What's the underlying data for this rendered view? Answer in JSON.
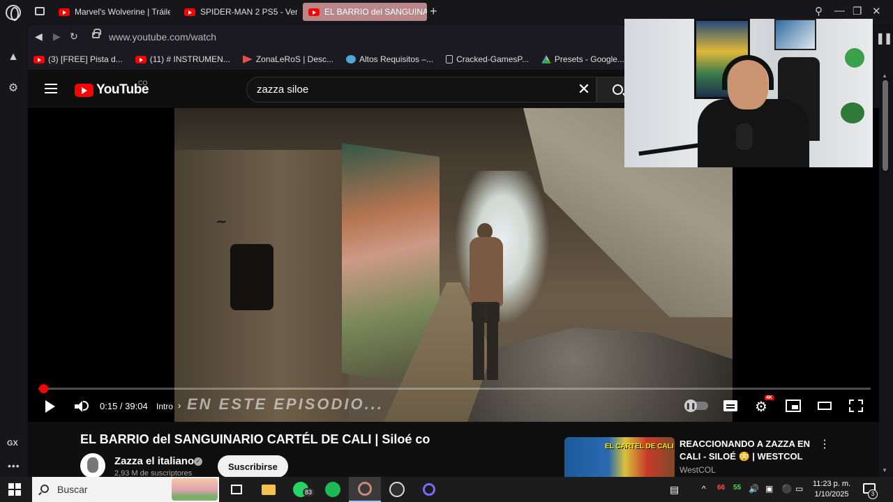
{
  "browser": {
    "tabs": [
      {
        "label": "Marvel's Wolverine | Tráile",
        "icon": "youtube-icon"
      },
      {
        "label": "SPIDER-MAN 2 PS5 - Ver",
        "icon": "youtube-icon"
      },
      {
        "label": "EL BARRIO del SANGUINAR",
        "icon": "youtube-icon",
        "active": true
      }
    ],
    "url": "www.youtube.com/watch",
    "bookmarks": [
      {
        "label": "(3) [FREE] Pista d...",
        "icon": "youtube-icon"
      },
      {
        "label": "(11) # INSTRUMEN...",
        "icon": "youtube-icon"
      },
      {
        "label": "ZonaLeRoS | Desc...",
        "icon": "zonaleros-icon"
      },
      {
        "label": "Altos Requisitos –...",
        "icon": "globe-icon"
      },
      {
        "label": "Cracked-GamesP...",
        "icon": "page-icon"
      },
      {
        "label": "Presets - Google...",
        "icon": "drive-icon"
      }
    ],
    "sidebar_label": "GX"
  },
  "youtube": {
    "logo_text": "YouTube",
    "country": "CO",
    "search_value": "zazza siloe",
    "player": {
      "time": "0:15 / 39:04",
      "chapter": "Intro",
      "caption_overlay": "EN ESTE EPISODIO...",
      "progress_fraction": 0.006,
      "quality_badge": "4K"
    },
    "video_title": "EL BARRIO del SANGUINARIO CARTÉL DE CALI | Siloé co",
    "channel": {
      "name": "Zazza el italiano",
      "subscribers": "2,93 M de suscriptores",
      "subscribe_label": "Suscribirse"
    },
    "recommended": {
      "title": "REACCIONANDO A ZAZZA EN CALI - SILOÉ 😳 | WESTCOL",
      "channel": "WestCOL",
      "thumb_text": "EL CARTEL DE CALI"
    }
  },
  "taskbar": {
    "search_placeholder": "Buscar",
    "whatsapp_badge": "83",
    "tray_temp_1": "66",
    "tray_temp_2": "55",
    "time": "11:23 p. m.",
    "date": "1/10/2025",
    "notifications": "3"
  },
  "colors": {
    "accent_red": "#ff0000",
    "active_tab": "#b8878a",
    "yt_bg": "#0f0f0f"
  }
}
